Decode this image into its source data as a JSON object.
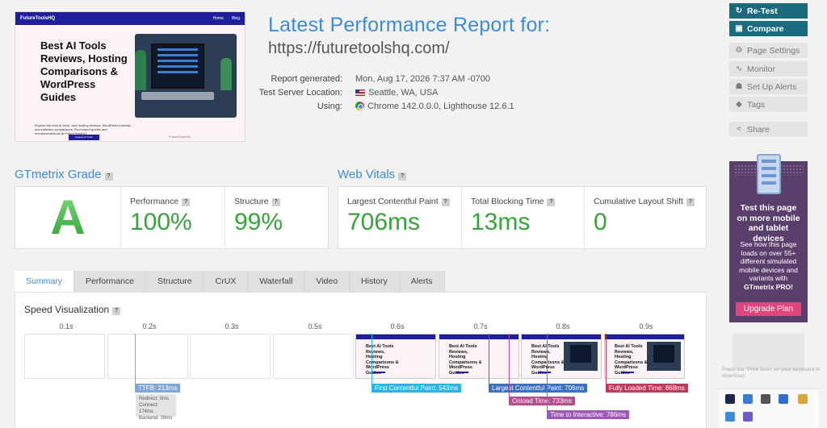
{
  "thumbnail": {
    "logo": "FutureToolsHQ",
    "nav_links": [
      "Home",
      "Blog"
    ],
    "headline": "Best AI Tools Reviews, Hosting Comparisons & WordPress Guides",
    "description": "Explore the best AI tools, web hosting reviews, WordPress tutorials, and software comparisons. Find expert guides and recommendations at FutureToolsHQ.",
    "button_label": "Explore AI Tools",
    "caption": "FutureToolsHQ"
  },
  "report": {
    "title": "Latest Performance Report for:",
    "url": "https://futuretoolshq.com/",
    "meta": [
      {
        "key": "Report generated:",
        "value": "Mon, Aug 17, 2026 7:37 AM -0700",
        "icon": ""
      },
      {
        "key": "Test Server Location:",
        "value": "Seattle, WA, USA",
        "icon": "us-flag-icon"
      },
      {
        "key": "Using:",
        "value": "Chrome 142.0.0.0, Lighthouse 12.6.1",
        "icon": "chrome-icon"
      }
    ]
  },
  "actions": {
    "retest": "Re-Test",
    "compare": "Compare",
    "page_settings": "Page Settings",
    "monitor": "Monitor",
    "set_up_alerts": "Set Up Alerts",
    "tags": "Tags",
    "share": "Share"
  },
  "promo": {
    "headline": "Test this page on more mobile and tablet devices",
    "body_pre": "See how this page loads on over 55+ different simulated mobile devices and variants with",
    "body_brand": "GTmetrix PRO!",
    "button": "Upgrade Plan"
  },
  "grade": {
    "title": "GTmetrix Grade",
    "letter": "A",
    "performance_label": "Performance",
    "performance_value": "100%",
    "structure_label": "Structure",
    "structure_value": "99%"
  },
  "vitals": {
    "title": "Web Vitals",
    "items": [
      {
        "label": "Largest Contentful Paint",
        "value": "706ms"
      },
      {
        "label": "Total Blocking Time",
        "value": "13ms"
      },
      {
        "label": "Cumulative Layout Shift",
        "value": "0"
      }
    ]
  },
  "tabs": [
    "Summary",
    "Performance",
    "Structure",
    "CrUX",
    "Waterfall",
    "Video",
    "History",
    "Alerts"
  ],
  "active_tab": "Summary",
  "speed_viz": {
    "title": "Speed Visualization",
    "ticks": [
      "0.1s",
      "0.2s",
      "0.3s",
      "0.5s",
      "0.6s",
      "0.7s",
      "0.8s",
      "0.9s"
    ],
    "frame_text": "Best AI Tools Reviews, Hosting Comparisons & WordPress Guides",
    "ttfb": "TTFB: 213ms",
    "ttfb_details": [
      "Redirect: 0ms",
      "Connect: 174ms",
      "Backend: 39ms"
    ],
    "fcp": "First Contentful Paint: 543ms",
    "lcp": "Largest Contentful Paint: 706ms",
    "onload": "Onload Time: 733ms",
    "tti": "Time to Interactive: 786ms",
    "fully_loaded": "Fully Loaded Time: 868ms"
  },
  "colors": {
    "accent": "#3d8cd8",
    "grade_green": "#37a33c",
    "primary_button": "#1b6b7f",
    "promo_bg": "#5a3e6c",
    "upgrade_button": "#e0457b",
    "ttfb": "#7fa6d6",
    "fcp": "#2bb3e6",
    "lcp": "#3a6fc4",
    "onload": "#b54e8e",
    "tti": "#9b59b6",
    "fully_loaded": "#c0395a"
  },
  "hint": "Press the \"Print Scrn\" on your keyboard to download"
}
